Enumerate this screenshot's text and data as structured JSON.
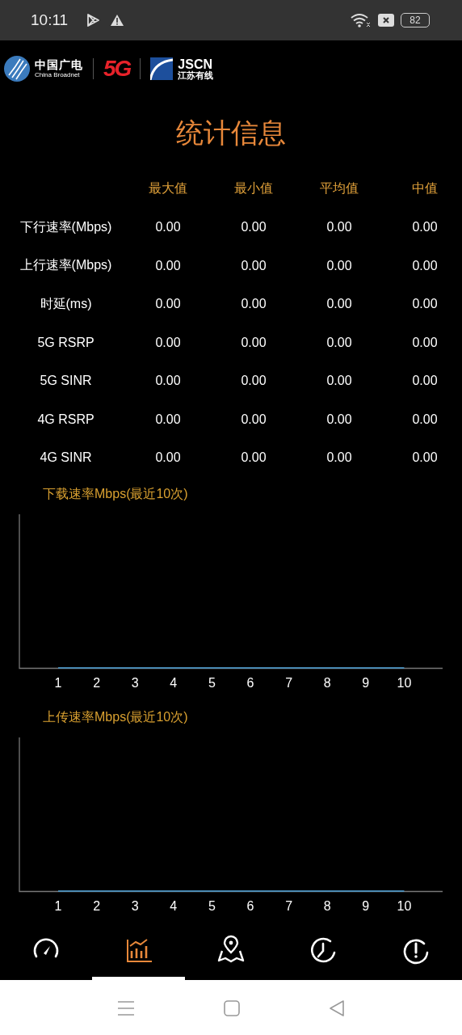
{
  "status_bar": {
    "time": "10:11",
    "battery": "82"
  },
  "header": {
    "broadnet_name": "中国广电",
    "broadnet_english": "China Broadnet",
    "fiveg": "5G",
    "jscn": "JSCN",
    "jscn_chinese": "江苏有线"
  },
  "title": "统计信息",
  "table": {
    "columns": [
      "最大值",
      "最小值",
      "平均值",
      "中值"
    ],
    "rows": [
      {
        "label": "下行速率(Mbps)",
        "values": [
          "0.00",
          "0.00",
          "0.00",
          "0.00"
        ]
      },
      {
        "label": "上行速率(Mbps)",
        "values": [
          "0.00",
          "0.00",
          "0.00",
          "0.00"
        ]
      },
      {
        "label": "时延(ms)",
        "values": [
          "0.00",
          "0.00",
          "0.00",
          "0.00"
        ]
      },
      {
        "label": "5G RSRP",
        "values": [
          "0.00",
          "0.00",
          "0.00",
          "0.00"
        ]
      },
      {
        "label": "5G SINR",
        "values": [
          "0.00",
          "0.00",
          "0.00",
          "0.00"
        ]
      },
      {
        "label": "4G RSRP",
        "values": [
          "0.00",
          "0.00",
          "0.00",
          "0.00"
        ]
      },
      {
        "label": "4G SINR",
        "values": [
          "0.00",
          "0.00",
          "0.00",
          "0.00"
        ]
      }
    ]
  },
  "charts": [
    {
      "title": "下载速率Mbps(最近10次)",
      "x_labels": [
        "1",
        "2",
        "3",
        "4",
        "5",
        "6",
        "7",
        "8",
        "9",
        "10"
      ]
    },
    {
      "title": "上传速率Mbps(最近10次)",
      "x_labels": [
        "1",
        "2",
        "3",
        "4",
        "5",
        "6",
        "7",
        "8",
        "9",
        "10"
      ]
    }
  ],
  "bottom_nav": {
    "items": [
      {
        "kind": "gauge",
        "selected": false
      },
      {
        "kind": "chart",
        "selected": true
      },
      {
        "kind": "map",
        "selected": false
      },
      {
        "kind": "clock",
        "selected": false
      },
      {
        "kind": "alert",
        "selected": false
      }
    ]
  }
}
